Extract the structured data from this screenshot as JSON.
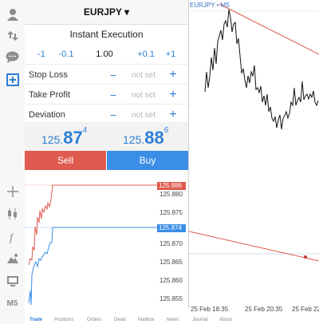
{
  "toolbar": {
    "icons": [
      "account-icon",
      "trade-arrows-icon",
      "chat-icon",
      "new-order-icon",
      "crosshair-icon",
      "candles-icon",
      "indicators-icon",
      "objects-icon",
      "templates-icon"
    ],
    "timeframe": "M5"
  },
  "order": {
    "symbol": "EURJPY ▾",
    "execution": "Instant Execution",
    "volume": {
      "minus1": "-1",
      "minus01": "-0.1",
      "value": "1.00",
      "plus01": "+0.1",
      "plus1": "+1"
    },
    "rows": [
      {
        "label": "Stop Loss",
        "value": "not set"
      },
      {
        "label": "Take Profit",
        "value": "not set"
      },
      {
        "label": "Deviation",
        "value": "not set"
      }
    ],
    "row_minus": "−",
    "row_plus": "+",
    "bid": {
      "prefix": "125.",
      "big": "87",
      "sup": "4"
    },
    "ask": {
      "prefix": "125.",
      "big": "88",
      "sup": "6"
    },
    "sell_label": "Sell",
    "buy_label": "Buy"
  },
  "mini_chart": {
    "ask_tag": "125.886",
    "bid_tag": "125.874",
    "ticks": [
      "125.880",
      "125.875",
      "125.870",
      "125.865",
      "125.860",
      "125.855"
    ],
    "colors": {
      "ask": "#e05a4f",
      "bid": "#3a8ee6"
    }
  },
  "main_chart": {
    "label": "EURJPY • M5",
    "times": [
      "25 Feb 18:35",
      "25 Feb 20:35",
      "25 Feb 22"
    ]
  },
  "tabs": [
    "Trade",
    "Positions",
    "Orders",
    "Deals",
    "Mailbox",
    "News",
    "Journal",
    "About"
  ]
}
